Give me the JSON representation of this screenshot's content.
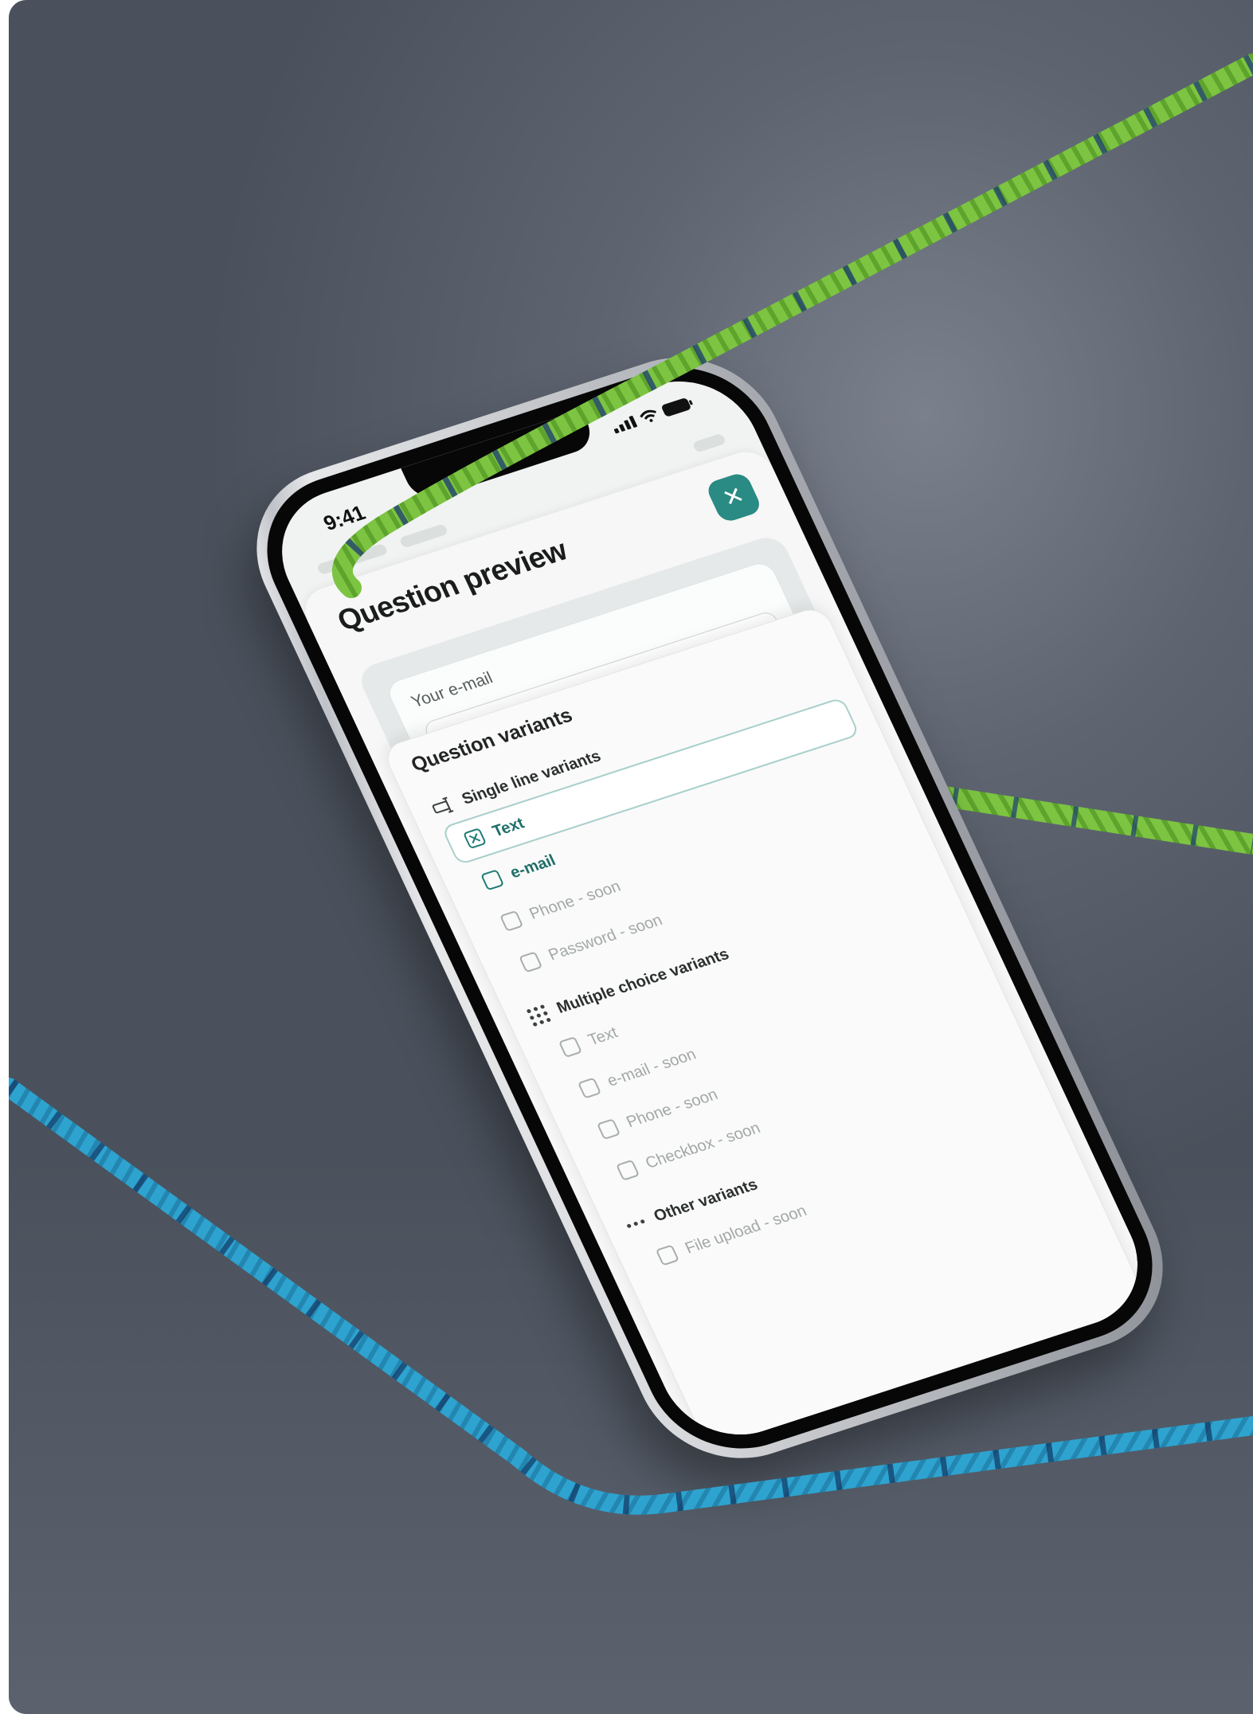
{
  "colors": {
    "accent": "#2a8a84",
    "accent_text": "#1f6f6a",
    "rope_green": "#7cc441",
    "rope_blue": "#2ea3cf",
    "background": "#5e6571"
  },
  "status_bar": {
    "time": "9:41",
    "icons": [
      "signal-icon",
      "wifi-icon",
      "battery-icon"
    ]
  },
  "sheet": {
    "title": "Question preview",
    "close_icon": "close-icon",
    "close_glyph": "✕"
  },
  "preview": {
    "field_label": "Your e-mail"
  },
  "variants": {
    "title": "Question variants",
    "groups": [
      {
        "label": "Single line variants",
        "icon": "text-cursor-icon",
        "options": [
          {
            "label": "Text",
            "checked": true,
            "enabled": true
          },
          {
            "label": "e-mail",
            "checked": false,
            "enabled": true
          },
          {
            "label": "Phone - soon",
            "checked": false,
            "enabled": false
          },
          {
            "label": "Password - soon",
            "checked": false,
            "enabled": false
          }
        ]
      },
      {
        "label": "Multiple choice variants",
        "icon": "dots-grid-icon",
        "options": [
          {
            "label": "Text",
            "checked": false,
            "enabled": false
          },
          {
            "label": "e-mail - soon",
            "checked": false,
            "enabled": false
          },
          {
            "label": "Phone - soon",
            "checked": false,
            "enabled": false
          },
          {
            "label": "Checkbox - soon",
            "checked": false,
            "enabled": false
          }
        ]
      },
      {
        "label": "Other variants",
        "icon": "more-horizontal-icon",
        "options": [
          {
            "label": "File upload - soon",
            "checked": false,
            "enabled": false
          }
        ]
      }
    ]
  }
}
